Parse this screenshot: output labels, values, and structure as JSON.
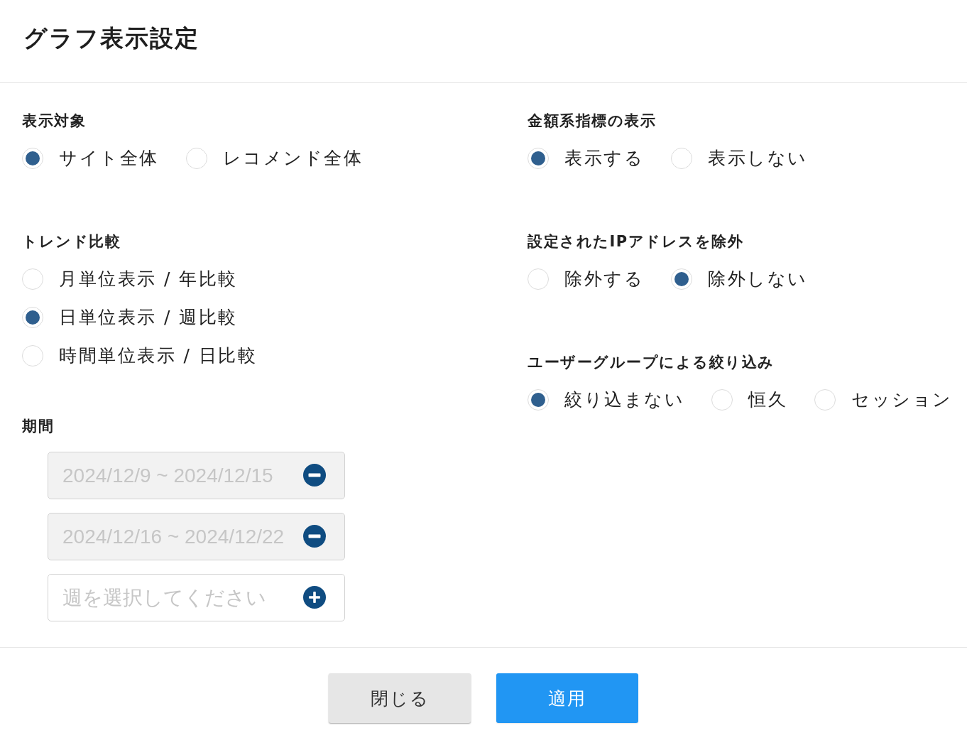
{
  "dialog": {
    "title": "グラフ表示設定"
  },
  "left_column": [
    {
      "kind": "radio_row",
      "label": "表示対象",
      "options": [
        {
          "label": "サイト全体",
          "selected": true
        },
        {
          "label": "レコメンド全体",
          "selected": false
        }
      ]
    },
    {
      "kind": "radio_list",
      "label": "トレンド比較",
      "options": [
        {
          "label": "月単位表示 / 年比較",
          "selected": false
        },
        {
          "label": "日単位表示 / 週比較",
          "selected": true
        },
        {
          "label": "時間単位表示 / 日比較",
          "selected": false
        }
      ]
    },
    {
      "kind": "period_list",
      "label": "期間",
      "fields": [
        {
          "kind": "week_range",
          "value": "2024/12/9 ~ 2024/12/15",
          "disabled": true
        },
        {
          "kind": "week_range",
          "value": "2024/12/16 ~ 2024/12/22",
          "disabled": true
        },
        {
          "kind": "week_picker",
          "placeholder": "週を選択してください",
          "disabled": false
        }
      ]
    }
  ],
  "right_column": [
    {
      "kind": "radio_row",
      "label": "金額系指標の表示",
      "options": [
        {
          "label": "表示する",
          "selected": true
        },
        {
          "label": "表示しない",
          "selected": false
        }
      ]
    },
    {
      "kind": "radio_row",
      "label": "設定されたIPアドレスを除外",
      "options": [
        {
          "label": "除外する",
          "selected": false
        },
        {
          "label": "除外しない",
          "selected": true
        }
      ]
    },
    {
      "kind": "radio_row",
      "label": "ユーザーグループによる絞り込み",
      "options": [
        {
          "label": "絞り込まない",
          "selected": true
        },
        {
          "label": "恒久",
          "selected": false
        },
        {
          "label": "セッション",
          "selected": false
        }
      ]
    }
  ],
  "footer": {
    "buttons": [
      {
        "label": "閉じる",
        "kind": "secondary"
      },
      {
        "label": "適用",
        "kind": "primary"
      }
    ]
  }
}
